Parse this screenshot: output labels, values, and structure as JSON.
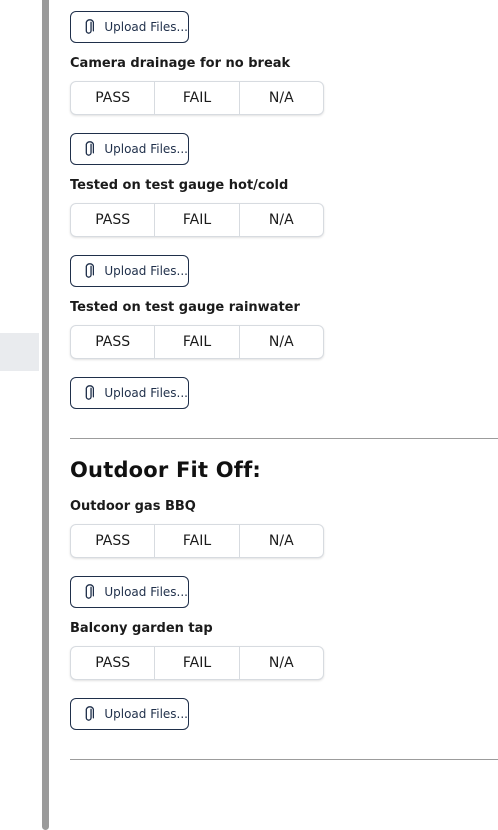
{
  "upload_label": "Upload Files...",
  "options": [
    "PASS",
    "FAIL",
    "N/A"
  ],
  "items_top": [
    {
      "title": "Camera drainage for no break"
    },
    {
      "title": "Tested on test gauge hot/cold"
    },
    {
      "title": "Tested on test gauge rainwater"
    }
  ],
  "section": {
    "title": "Outdoor Fit Off:",
    "items": [
      {
        "title": "Outdoor gas BBQ"
      },
      {
        "title": "Balcony garden tap"
      }
    ]
  }
}
